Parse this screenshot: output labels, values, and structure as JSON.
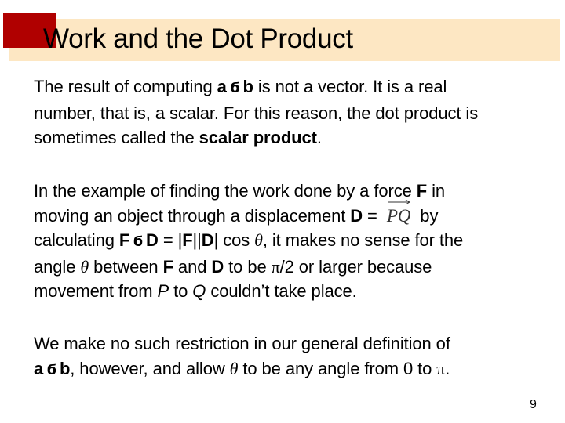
{
  "slide": {
    "title": "Work and the Dot Product",
    "page_number": "9",
    "colors": {
      "title_band": "#fde7c3",
      "accent_square": "#b00000"
    }
  },
  "dot_symbol": "ϭ",
  "para1": {
    "l1_a": "The result of computing ",
    "l1_b_bold1": "a",
    "l1_b_bold2": "b",
    "l1_c": " is not a vector. It is a real",
    "l2": "number, that is, a scalar. For this reason, the dot product is",
    "l3_a": "sometimes called the ",
    "l3_bold": "scalar product",
    "l3_c": "."
  },
  "para2": {
    "l1_a": "In the example of finding the work done by a force ",
    "l1_bold": "F",
    "l1_c": " in",
    "l2_a": "moving an object through a displacement ",
    "l2_bold": "D",
    "l2_eq": " = ",
    "l2_vec": "PQ",
    "l2_c": " by",
    "l3_a": "calculating ",
    "l3_F": "F",
    "l3_D": "D",
    "l3_eq": " = |",
    "l3_F2": "F",
    "l3_mid": "||",
    "l3_D2": "D",
    "l3_cos": "| cos ",
    "theta": "θ",
    "l3_c": ", it makes no sense for the",
    "l4_a": "angle ",
    "l4_b": " between ",
    "l4_F": "F",
    "l4_and": " and ",
    "l4_D": "D",
    "l4_c": " to be ",
    "pi": "π",
    "l4_d": "/2 or larger because",
    "l5_a": "movement from ",
    "l5_P": "P",
    "l5_to": " to ",
    "l5_Q": "Q",
    "l5_c": " couldn’t take place."
  },
  "para3": {
    "l1": "We make no such restriction in our general definition of",
    "l2_a": "a",
    "l2_b": "b",
    "l2_c": ", however, and allow ",
    "l2_d": " to be any angle from 0 to ",
    "l2_e": "."
  }
}
